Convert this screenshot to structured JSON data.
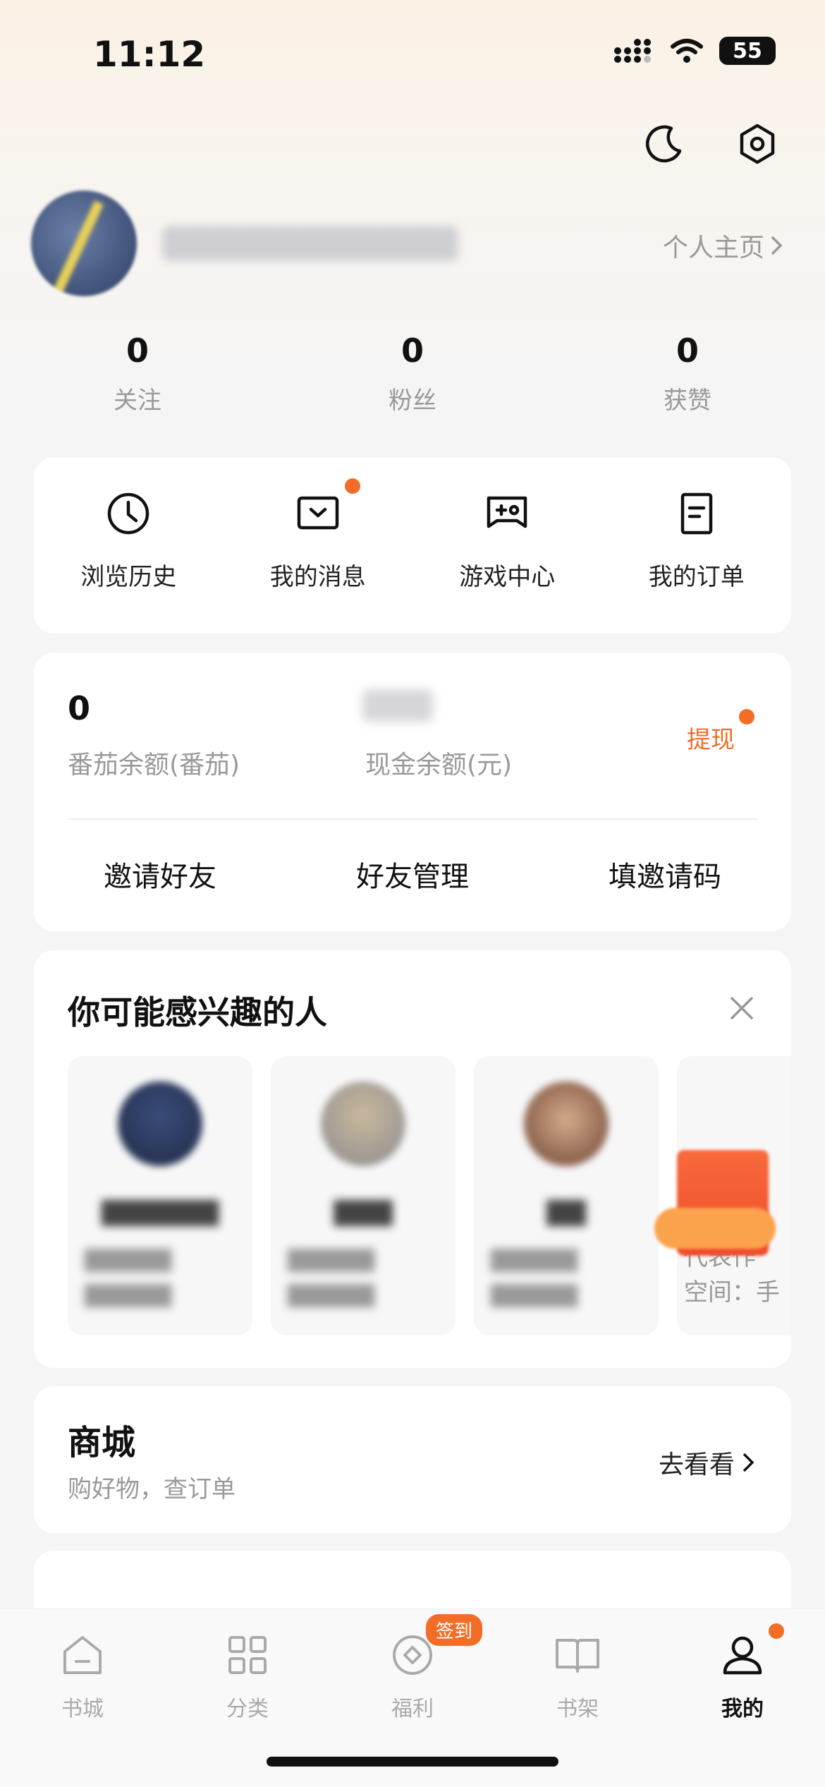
{
  "status_bar": {
    "time": "11:12",
    "battery": "55"
  },
  "header": {
    "profile_link": "个人主页"
  },
  "stats": [
    {
      "value": "0",
      "label": "关注"
    },
    {
      "value": "0",
      "label": "粉丝"
    },
    {
      "value": "0",
      "label": "获赞"
    }
  ],
  "quick_actions": [
    {
      "label": "浏览历史",
      "icon": "clock-icon"
    },
    {
      "label": "我的消息",
      "icon": "message-icon"
    },
    {
      "label": "游戏中心",
      "icon": "gamepad-icon"
    },
    {
      "label": "我的订单",
      "icon": "order-icon"
    }
  ],
  "wallet": {
    "tomato_balance": "0",
    "tomato_balance_label": "番茄余额(番茄)",
    "cash_balance_label": "现金余额(元)",
    "withdraw_label": "提现",
    "actions": [
      "邀请好友",
      "好友管理",
      "填邀请码"
    ]
  },
  "people": {
    "title": "你可能感兴趣的人",
    "partial_card_desc": [
      "代表作",
      "空间：手"
    ]
  },
  "mall": {
    "title": "商城",
    "subtitle": "购好物，查订单",
    "link": "去看看"
  },
  "tabbar": {
    "items": [
      {
        "label": "书城",
        "icon": "home-icon"
      },
      {
        "label": "分类",
        "icon": "grid-icon"
      },
      {
        "label": "福利",
        "icon": "coin-icon"
      },
      {
        "label": "书架",
        "icon": "book-icon"
      },
      {
        "label": "我的",
        "icon": "user-icon"
      }
    ],
    "signin_badge": "签到"
  },
  "colors": {
    "accent": "#f46d27"
  }
}
